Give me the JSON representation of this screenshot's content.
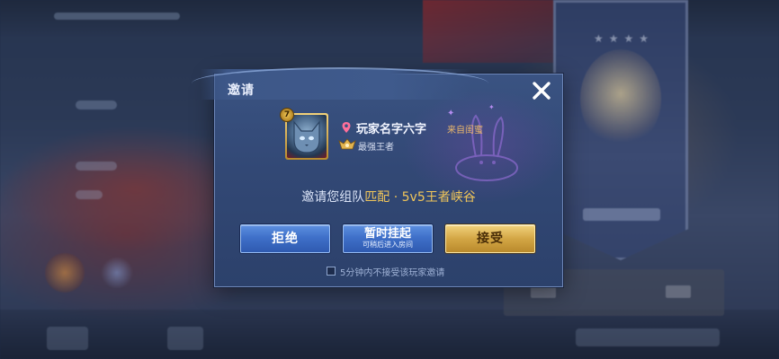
{
  "dialog": {
    "title": "邀请",
    "player": {
      "name": "玩家名字六字",
      "source": "来自闺蜜",
      "rank": "最强王者",
      "level_badge": "7"
    },
    "invite": {
      "prefix": "邀请您组队",
      "mode": "匹配",
      "separator": "·",
      "map": "5v5王者峡谷"
    },
    "buttons": {
      "reject": "拒绝",
      "later": "暂时挂起",
      "later_sub": "可稍后进入房间",
      "accept": "接受"
    },
    "checkbox_label": "5分钟内不接受该玩家邀请",
    "checkbox_checked": false
  },
  "colors": {
    "accent_gold": "#f1c65a",
    "button_blue": "#3f70c9",
    "button_gold": "#d3a645"
  },
  "icons": [
    "close-icon",
    "location-pin-icon",
    "rank-emblem-icon",
    "rabbit-icon"
  ]
}
